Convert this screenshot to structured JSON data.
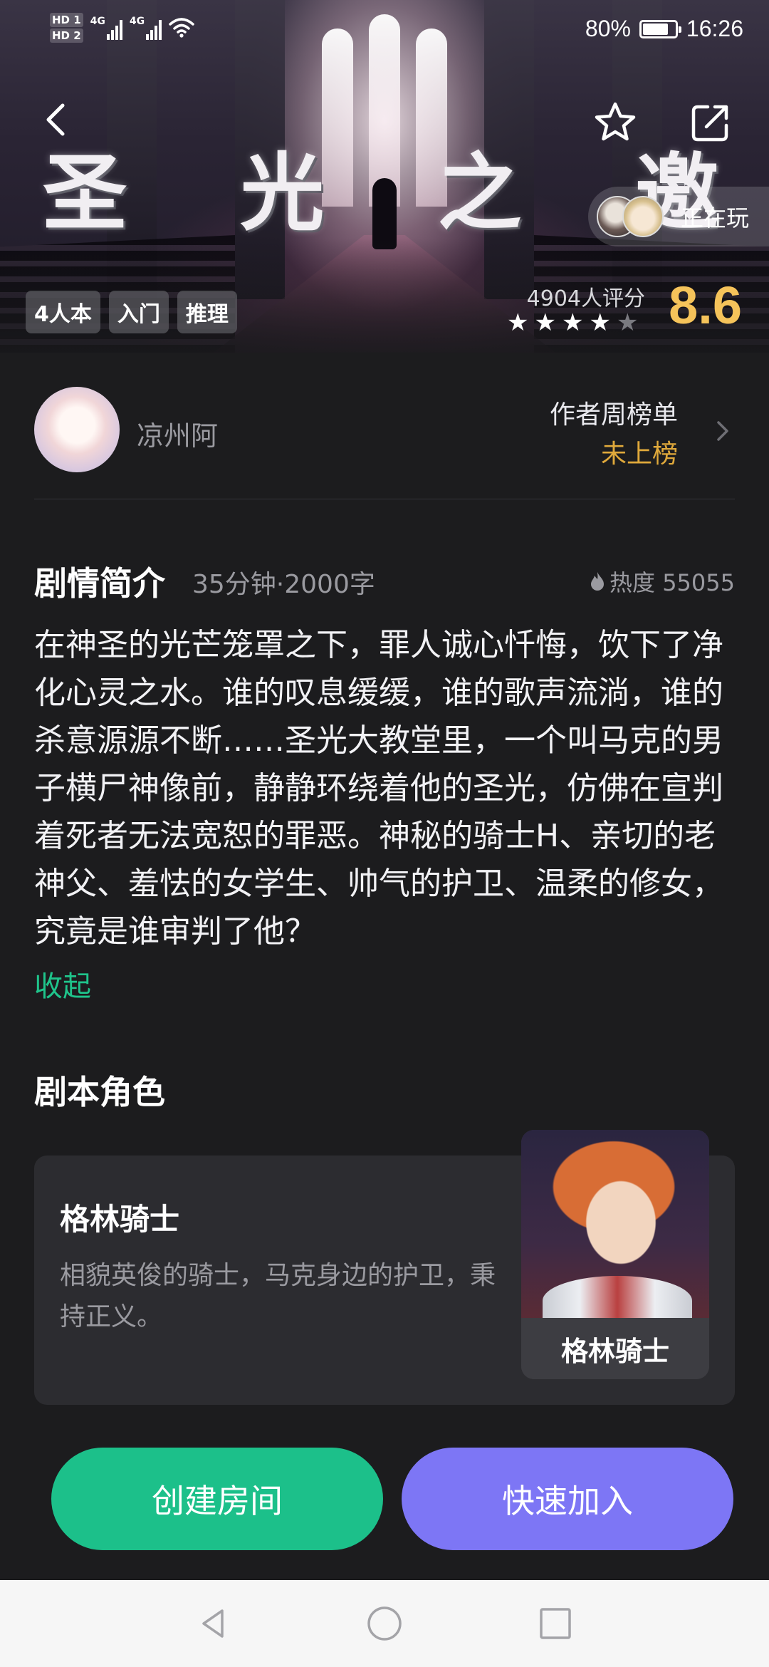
{
  "status_bar": {
    "hd1": "HD 1",
    "hd2": "HD 2",
    "net1": "4G",
    "net2": "4G",
    "battery_text": "80%",
    "battery_level": 0.8,
    "time": "16:26"
  },
  "hero": {
    "title_chars": [
      "圣",
      "光",
      "之",
      "邀"
    ],
    "playing_label": "正在玩",
    "tags": [
      "4人本",
      "入门",
      "推理"
    ],
    "rating_count": "4904人评分",
    "rating_stars": 4,
    "rating_stars_total": 5,
    "score": "8.6"
  },
  "author": {
    "name": "凉州阿",
    "rank_title": "作者周榜单",
    "rank_value": "未上榜"
  },
  "synopsis": {
    "title": "剧情简介",
    "meta": "35分钟·2000字",
    "heat_label": "热度 55055",
    "body": "在神圣的光芒笼罩之下，罪人诚心忏悔，饮下了净化心灵之水。谁的叹息缓缓，谁的歌声流淌，谁的杀意源源不断……圣光大教堂里，一个叫马克的男子横尸神像前，静静环绕着他的圣光，仿佛在宣判着死者无法宽恕的罪恶。神秘的骑士H、亲切的老神父、羞怯的女学生、帅气的护卫、温柔的修女，究竟是谁审判了他？",
    "collapse_label": "收起"
  },
  "roles": {
    "title": "剧本角色",
    "items": [
      {
        "name": "格林骑士",
        "desc": "相貌英俊的骑士，马克身边的护卫，秉持正义。",
        "pic_label": "格林骑士"
      }
    ]
  },
  "actions": {
    "create_label": "创建房间",
    "join_label": "快速加入"
  },
  "colors": {
    "accent_green": "#1cc08a",
    "accent_purple": "#7d76f5",
    "score_gold": "#f5c35a",
    "rank_gold": "#e0a93b",
    "background": "#1c1c1e"
  },
  "icons": {
    "back": "back-arrow-icon",
    "favorite": "star-outline-icon",
    "share": "share-icon",
    "heat": "flame-icon",
    "chevron": "chevron-right-icon",
    "nav_back": "nav-back-icon",
    "nav_home": "nav-home-icon",
    "nav_recents": "nav-recents-icon"
  }
}
